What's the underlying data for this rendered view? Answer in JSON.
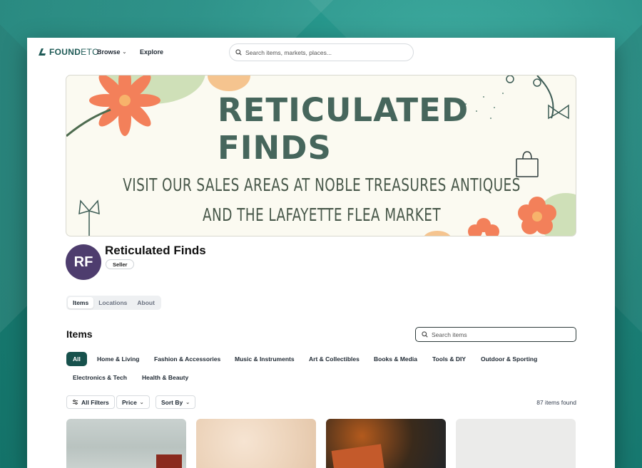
{
  "header": {
    "logo_found": "FOUND",
    "logo_etc": "ETC",
    "browse_label": "Browse",
    "explore_label": "Explore",
    "search_placeholder": "Search items, markets, places..."
  },
  "banner": {
    "title": "Reticulated Finds",
    "line1": "Visit our sales areas at Noble Treasures Antiques",
    "line2": "and the Lafayette Flea Market"
  },
  "profile": {
    "initials": "RF",
    "name": "Reticulated Finds",
    "badge": "Seller",
    "avatar_color": "#4e3d6e"
  },
  "tabs": [
    {
      "label": "Items",
      "active": true
    },
    {
      "label": "Locations",
      "active": false
    },
    {
      "label": "About",
      "active": false
    }
  ],
  "items": {
    "title": "Items",
    "search_placeholder": "Search items",
    "categories": [
      "All",
      "Home & Living",
      "Fashion & Accessories",
      "Music & Instruments",
      "Art & Collectibles",
      "Books & Media",
      "Tools & DIY",
      "Outdoor & Sporting",
      "Electronics & Tech",
      "Health & Beauty"
    ],
    "active_category": "All",
    "filters": {
      "all_filters": "All Filters",
      "price": "Price",
      "sort_by": "Sort By"
    },
    "count_text": "87 items found"
  },
  "colors": {
    "accent": "#17514c",
    "banner_bg": "#fbfaf1",
    "banner_text": "#46665c"
  }
}
